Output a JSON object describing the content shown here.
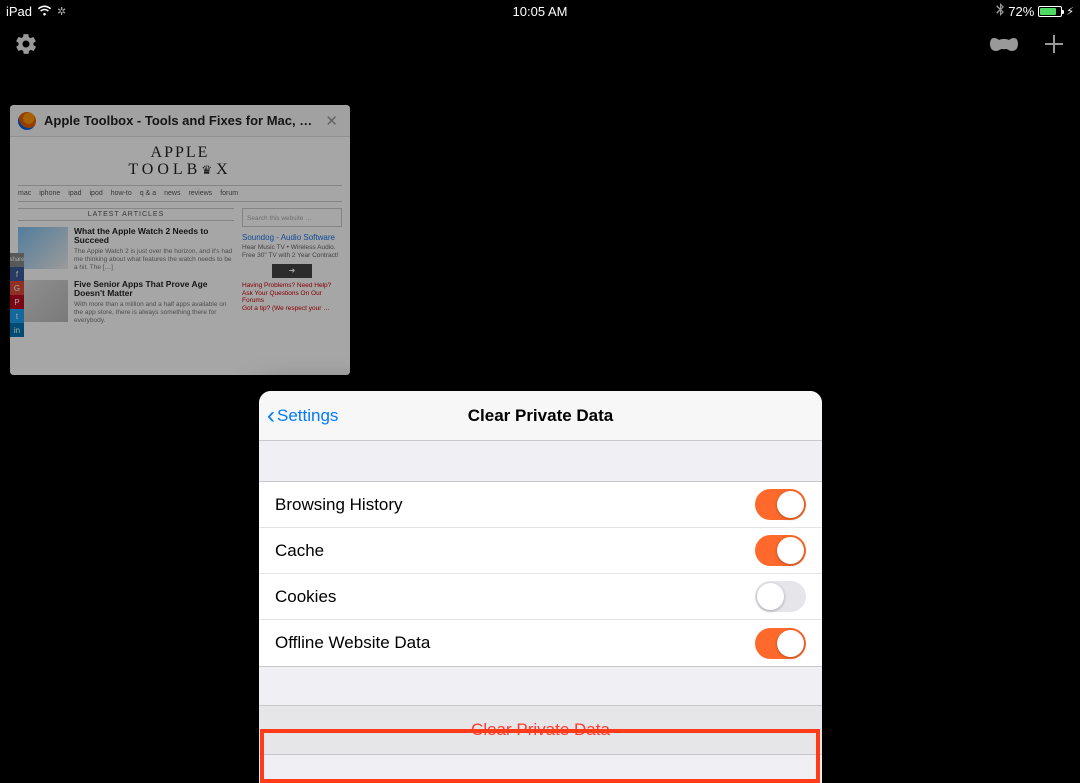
{
  "status": {
    "device": "iPad",
    "time": "10:05 AM",
    "battery_pct": "72%"
  },
  "tab": {
    "title": "Apple Toolbox - Tools and Fixes for Mac, iPad,…",
    "site_logo_line1": "APPLE",
    "site_logo_line2": "TOOLB  X",
    "nav_items": [
      "Mac",
      "iPhone",
      "iPad",
      "iPod",
      "How-to",
      "Q & A",
      "News",
      "Reviews",
      "Forum"
    ],
    "latest_heading": "LATEST ARTICLES",
    "article1": {
      "headline": "What the Apple Watch 2 Needs to Succeed",
      "desc": "The Apple Watch 2 is just over the horizon, and it's had me thinking about what features the watch needs to be a hit. The […]"
    },
    "article2": {
      "headline": "Five Senior Apps That Prove Age Doesn't Matter",
      "desc": "With more than a million and a half apps available on the app store, there is always something there for everybody."
    },
    "sidebar": {
      "search_placeholder": "Search this website …",
      "ad_title": "Soundog - Audio Software",
      "ad_desc": "Hear Music TV • Wireless Audio. Free 30\" TV with 2 Year Contract!",
      "ad_arrow": "➜",
      "foot1": "Having Problems? Need Help? Ask Your Questions On Our Forums",
      "foot2": "Got a tip? (We respect your …"
    }
  },
  "modal": {
    "back_label": "Settings",
    "title": "Clear Private Data",
    "rows": [
      {
        "label": "Browsing History",
        "on": true
      },
      {
        "label": "Cache",
        "on": true
      },
      {
        "label": "Cookies",
        "on": false
      },
      {
        "label": "Offline Website Data",
        "on": true
      }
    ],
    "action_label": "Clear Private Data"
  }
}
